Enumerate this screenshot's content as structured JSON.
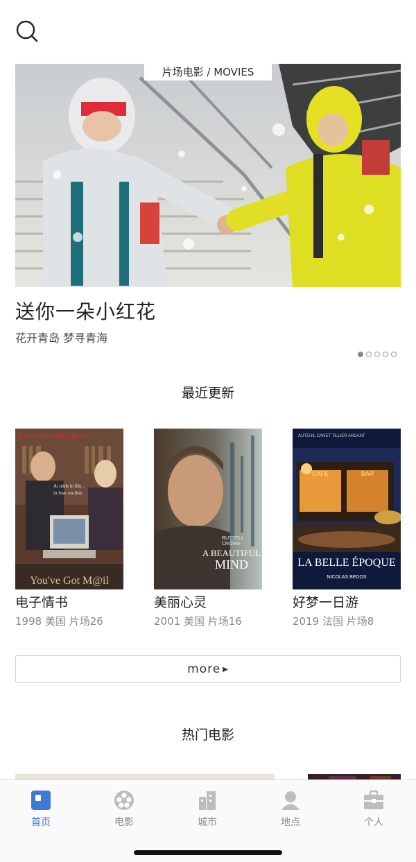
{
  "banner": {
    "tag": "片场电影 / MOVIES",
    "title": "送你一朵小红花",
    "subtitle": "花开青岛 梦寻青海",
    "page_count": 5,
    "active_page": 1
  },
  "recent": {
    "title": "最近更新",
    "movies": [
      {
        "title": "电子情书",
        "meta": "1998 美国 片场26",
        "poster_text": "You've Got M@il",
        "poster_top": "Tom Hanks   Meg Ryan",
        "poster_mid": "At odds in life... in love on-line."
      },
      {
        "title": "美丽心灵",
        "meta": "2001 美国 片场16",
        "poster_text": "A BEAUTIFUL MIND",
        "poster_top": "RUSSELL CROWE"
      },
      {
        "title": "好梦一日游",
        "meta": "2019 法国 片场8",
        "poster_text": "LA BELLE ÉPOQUE",
        "poster_top": "AUTEUIL   CANET   TILLIER   ARDANT",
        "poster_bottom": "NICOLAS BEDOS"
      }
    ],
    "more_label": "more"
  },
  "hot": {
    "title": "热门电影"
  },
  "tabs": [
    {
      "label": "首页",
      "icon": "home-icon",
      "active": true
    },
    {
      "label": "电影",
      "icon": "film-reel-icon",
      "active": false
    },
    {
      "label": "城市",
      "icon": "city-icon",
      "active": false
    },
    {
      "label": "地点",
      "icon": "location-person-icon",
      "active": false
    },
    {
      "label": "个人",
      "icon": "briefcase-icon",
      "active": false
    }
  ],
  "colors": {
    "accent": "#3b7bd4",
    "inactive": "#b9b9b9"
  }
}
